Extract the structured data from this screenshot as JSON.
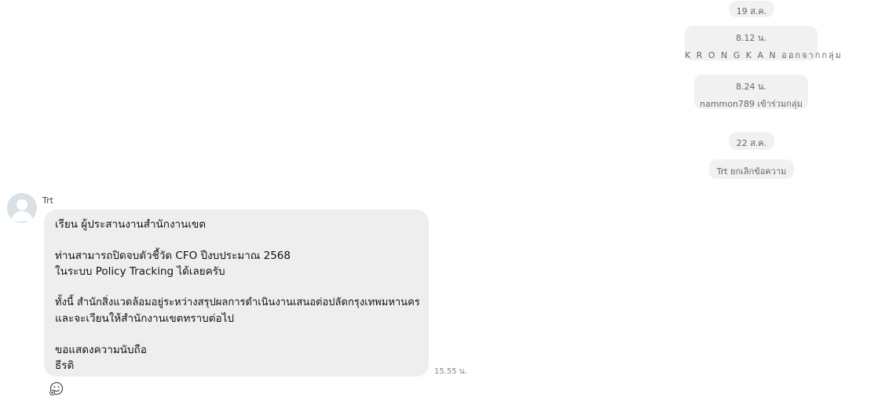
{
  "system_messages": [
    {
      "id": "date-19",
      "lines": [
        "19 ส.ค."
      ]
    },
    {
      "id": "left-group",
      "lines": [
        "8.12 น.",
        "K R O N G K A N ออกจากกลุ่ม"
      ]
    },
    {
      "id": "joined-group",
      "lines": [
        "8.24 น.",
        "nammon789 เข้าร่วมกลุ่ม"
      ]
    },
    {
      "id": "date-22",
      "lines": [
        "22 ส.ค."
      ]
    },
    {
      "id": "unsent",
      "lines": [
        "Trt ยกเลิกข้อความ"
      ]
    }
  ],
  "message": {
    "sender": "Trt",
    "lines": [
      "เรียน ผู้ประสานงานสำนักงานเขต",
      "",
      "ท่านสามารถปิดจบตัวชี้วัด CFO ปีงบประมาณ 2568",
      "ในระบบ Policy Tracking ได้เลยครับ",
      "",
      "ทั้งนี้ สำนักสิ่งแวดล้อมอยู่ระหว่างสรุปผลการดำเนินงานเสนอต่อปลัดกรุงเทพมหานคร",
      "และจะเวียนให้สำนักงานเขตทราบต่อไป",
      "",
      "ขอแสดงความนับถือ",
      "ธีรติ"
    ],
    "time": "15.55 น."
  },
  "icons": {
    "avatar": "default-user-avatar-icon",
    "reaction": "add-reaction-smiley-icon"
  },
  "colors": {
    "bubble": "#eeeeee",
    "system_pill": "#f1f1f1",
    "avatar_bg": "#d7e1e6"
  }
}
